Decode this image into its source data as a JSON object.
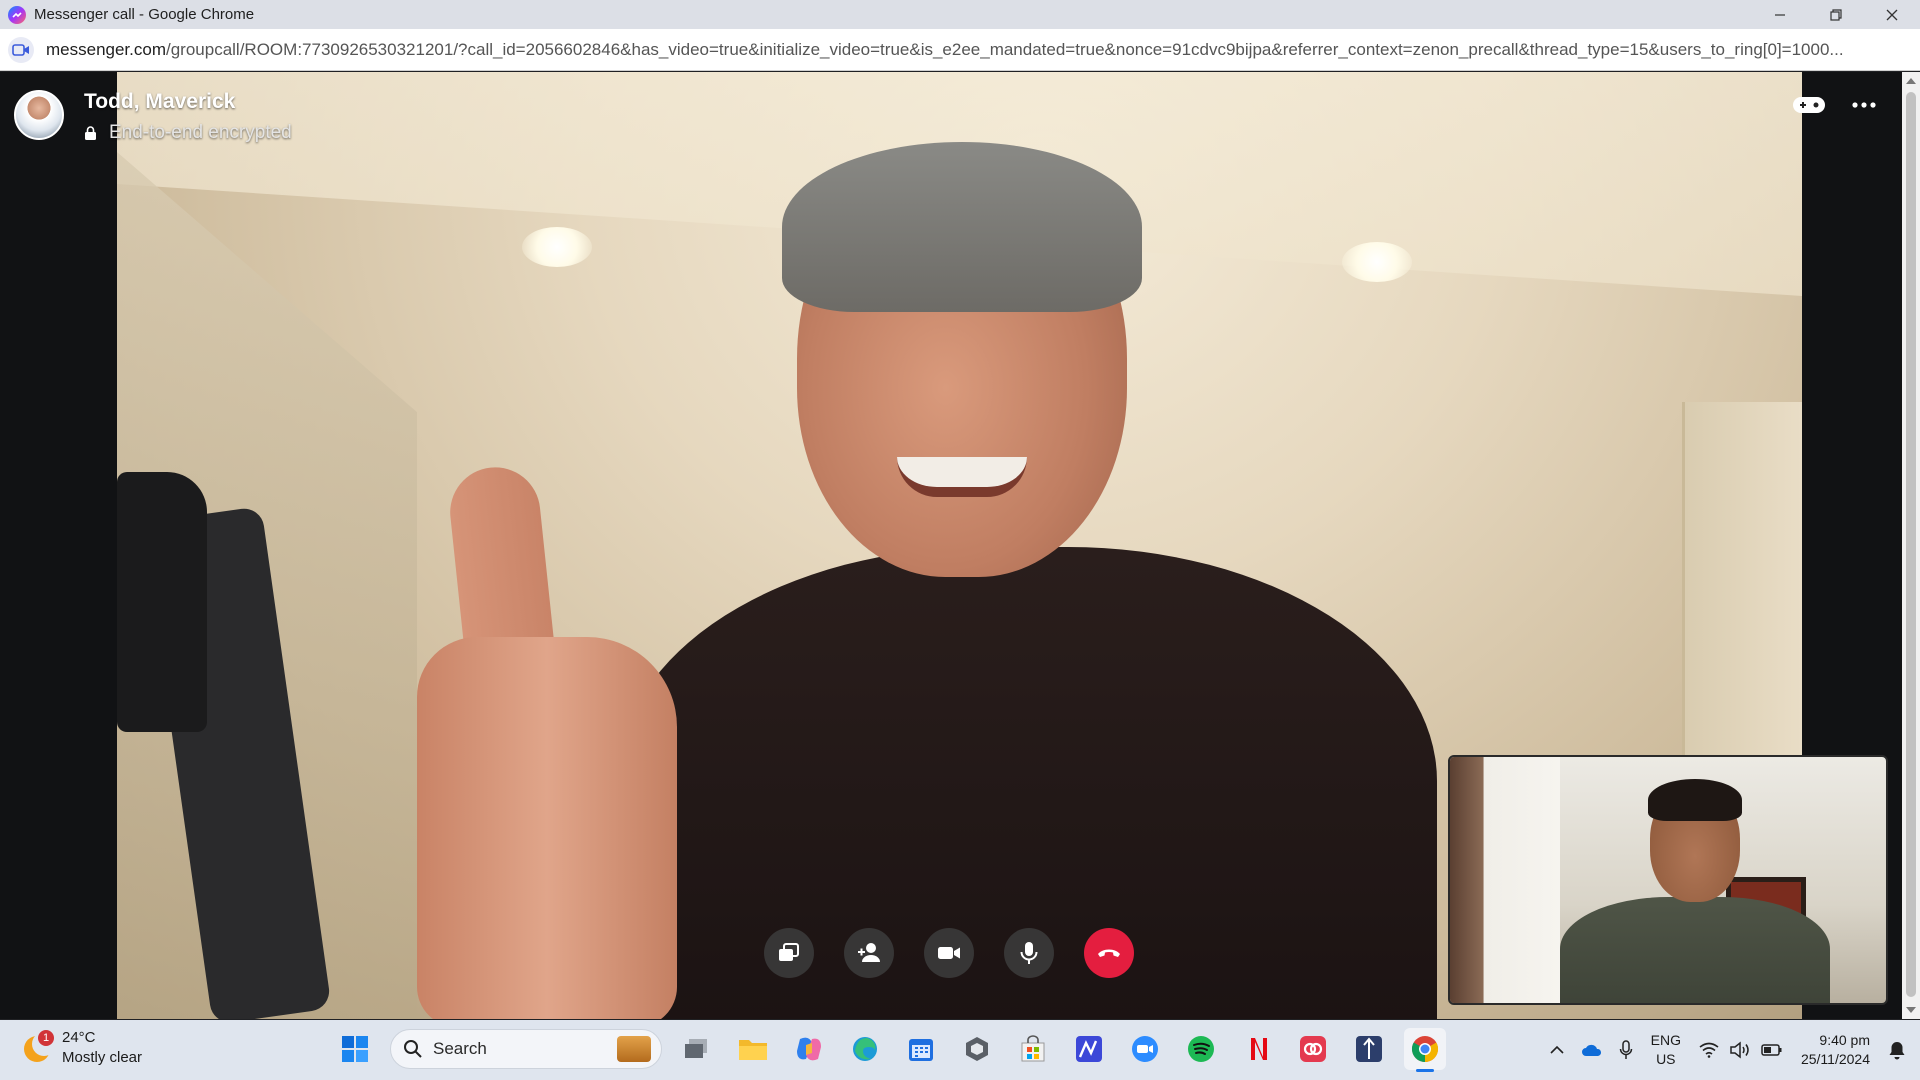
{
  "window": {
    "title": "Messenger call - Google Chrome"
  },
  "address_bar": {
    "host": "messenger.com",
    "path": "/groupcall/ROOM:7730926530321201/?call_id=2056602846&has_video=true&initialize_video=true&is_e2ee_mandated=true&nonce=91cdvc9bijpa&referrer_context=zenon_precall&thread_type=15&users_to_ring[0]=1000..."
  },
  "call": {
    "caller_name": "Todd, Maverick",
    "encryption_label": "End-to-end encrypted",
    "controls": [
      {
        "name": "share-screen",
        "icon": "share-screen-icon"
      },
      {
        "name": "add-person",
        "icon": "add-person-icon"
      },
      {
        "name": "camera",
        "icon": "video-camera-icon"
      },
      {
        "name": "microphone",
        "icon": "microphone-icon"
      },
      {
        "name": "end-call",
        "icon": "hang-up-icon",
        "color": "#e41e3f"
      }
    ]
  },
  "taskbar": {
    "weather": {
      "temperature": "24°C",
      "condition": "Mostly clear",
      "badge": "1"
    },
    "search_label": "Search",
    "language": {
      "line1": "ENG",
      "line2": "US"
    },
    "clock": {
      "time": "9:40 pm",
      "date": "25/11/2024"
    },
    "pinned_apps": [
      "start",
      "task-view",
      "file-explorer",
      "copilot",
      "edge",
      "calendar",
      "unity",
      "microsoft-store",
      "mathway",
      "zoom",
      "spotify",
      "netflix",
      "creative-cloud",
      "ssh-client",
      "chrome"
    ]
  },
  "colors": {
    "end_call": "#e41e3f",
    "taskbar_bg": "#dfe5ee",
    "accent": "#1a73e8"
  }
}
